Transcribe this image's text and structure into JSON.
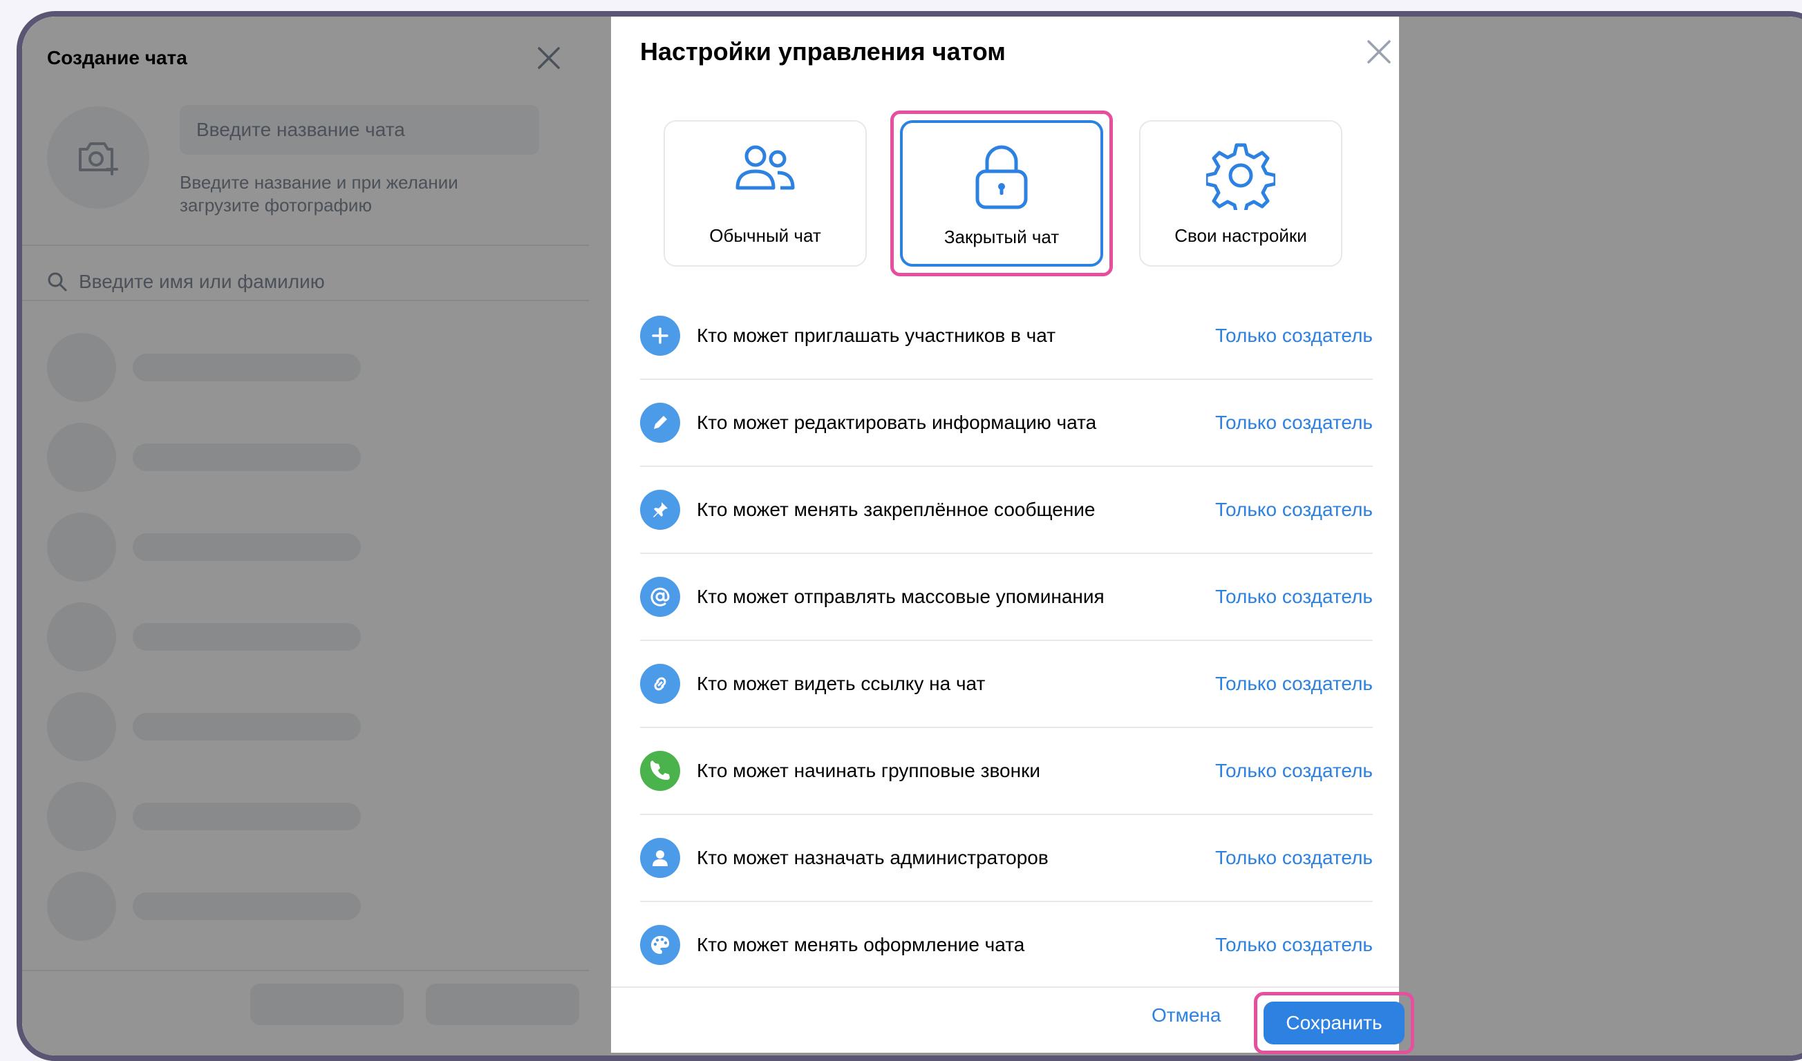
{
  "left_panel": {
    "title": "Создание чата",
    "name_placeholder": "Введите название чата",
    "hint": "Введите название и при желании загрузите фотографию",
    "search_placeholder": "Введите имя или фамилию"
  },
  "modal": {
    "title": "Настройки управления чатом",
    "presets": [
      {
        "label": "Обычный чат",
        "icon": "users-icon",
        "selected": false
      },
      {
        "label": "Закрытый чат",
        "icon": "lock-icon",
        "selected": true
      },
      {
        "label": "Свои настройки",
        "icon": "gear-icon",
        "selected": false
      }
    ],
    "settings": [
      {
        "text": "Кто может приглашать участников в чат",
        "value": "Только создатель",
        "icon": "plus-icon",
        "color": "#4b9be8"
      },
      {
        "text": "Кто может редактировать информацию чата",
        "value": "Только создатель",
        "icon": "pencil-icon",
        "color": "#4b9be8"
      },
      {
        "text": "Кто может менять закреплённое сообщение",
        "value": "Только создатель",
        "icon": "pin-icon",
        "color": "#4b9be8"
      },
      {
        "text": "Кто может отправлять массовые упоминания",
        "value": "Только создатель",
        "icon": "at-icon",
        "color": "#4b9be8"
      },
      {
        "text": "Кто может видеть ссылку на чат",
        "value": "Только создатель",
        "icon": "link-icon",
        "color": "#4b9be8"
      },
      {
        "text": "Кто может начинать групповые звонки",
        "value": "Только создатель",
        "icon": "phone-icon",
        "color": "#4bb34b"
      },
      {
        "text": "Кто может назначать администраторов",
        "value": "Только создатель",
        "icon": "user-icon",
        "color": "#4b9be8"
      },
      {
        "text": "Кто может менять оформление чата",
        "value": "Только создатель",
        "icon": "palette-icon",
        "color": "#4b9be8"
      }
    ],
    "cancel_label": "Отмена",
    "save_label": "Сохранить"
  },
  "colors": {
    "accent": "#2d81e0",
    "highlight": "#e64e9e"
  }
}
